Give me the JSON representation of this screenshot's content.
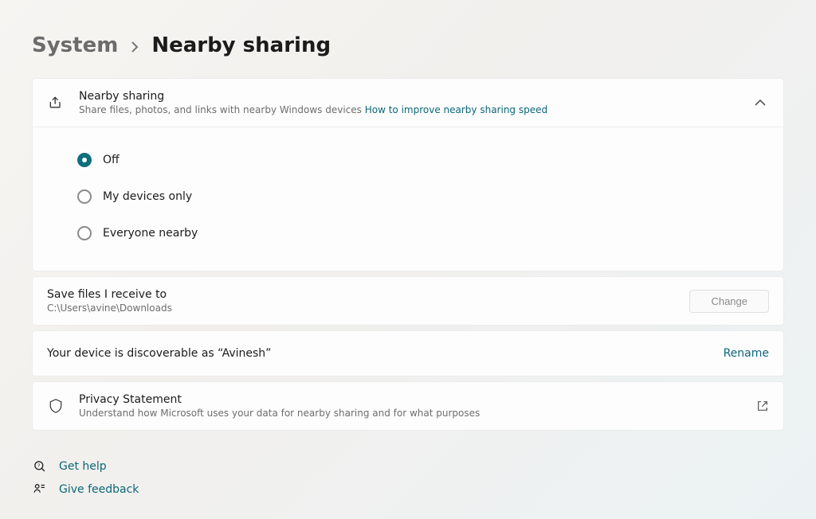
{
  "breadcrumb": {
    "parent": "System",
    "current": "Nearby sharing"
  },
  "sharing_section": {
    "title": "Nearby sharing",
    "subtitle_prefix": "Share files, photos, and links with nearby Windows devices ",
    "subtitle_link": "How to improve nearby sharing speed",
    "options": [
      {
        "label": "Off",
        "selected": true
      },
      {
        "label": "My devices only",
        "selected": false
      },
      {
        "label": "Everyone nearby",
        "selected": false
      }
    ]
  },
  "save_location": {
    "title": "Save files I receive to",
    "path": "C:\\Users\\avine\\Downloads",
    "button": "Change"
  },
  "discoverable": {
    "text": "Your device is discoverable as “Avinesh”",
    "action": "Rename"
  },
  "privacy": {
    "title": "Privacy Statement",
    "subtitle": "Understand how Microsoft uses your data for nearby sharing and for what purposes"
  },
  "footer": {
    "help": "Get help",
    "feedback": "Give feedback"
  }
}
